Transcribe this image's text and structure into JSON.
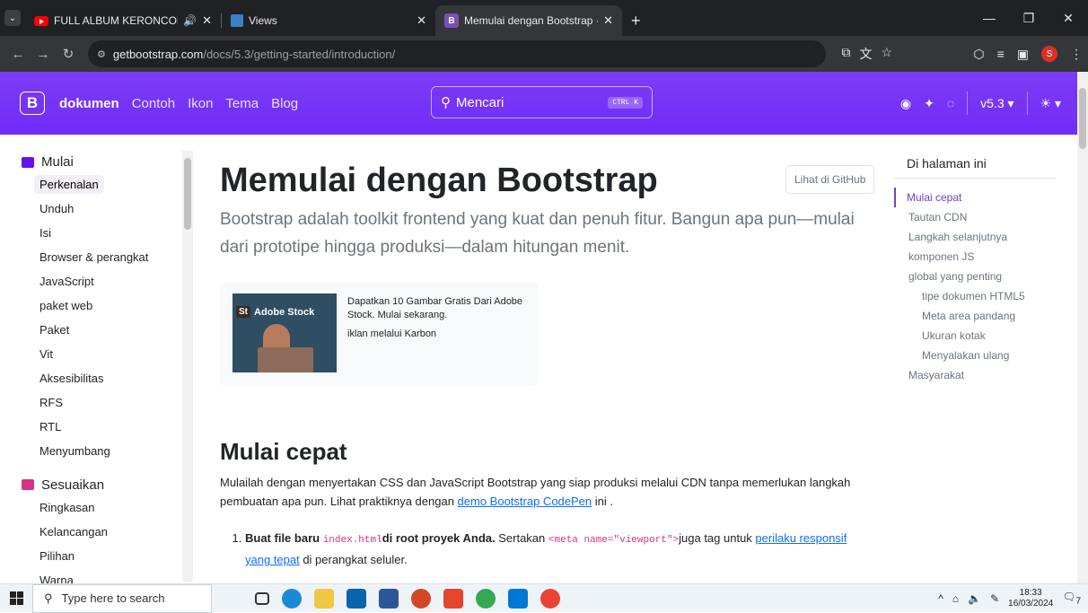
{
  "browser": {
    "tabs": [
      {
        "title": "FULL ALBUM KERONCONG",
        "icon": "youtube-icon",
        "audio": "🔊"
      },
      {
        "title": "Views",
        "icon": "views-icon"
      },
      {
        "title": "Memulai dengan Bootstrap · Bo",
        "icon": "bootstrap-icon"
      }
    ],
    "url_host": "getbootstrap.com",
    "url_path": "/docs/5.3/getting-started/introduction/"
  },
  "navbar": {
    "logo": "B",
    "links": [
      "dokumen",
      "Contoh",
      "Ikon",
      "Tema",
      "Blog"
    ],
    "search_placeholder": "Mencari",
    "search_kbd": "CTRL K",
    "version": "v5.3"
  },
  "sidebar": {
    "section1": {
      "title": "Mulai",
      "items": [
        "Perkenalan",
        "Unduh",
        "Isi",
        "Browser & perangkat",
        "JavaScript",
        "paket web",
        "Paket",
        "Vit",
        "Aksesibilitas",
        "RFS",
        "RTL",
        "Menyumbang"
      ]
    },
    "section2": {
      "title": "Sesuaikan",
      "items": [
        "Ringkasan",
        "Kelancangan",
        "Pilihan",
        "Warna"
      ]
    }
  },
  "main": {
    "title": "Memulai dengan Bootstrap",
    "github_button": "Lihat di GitHub",
    "lead": "Bootstrap adalah toolkit frontend yang kuat dan penuh fitur. Bangun apa pun—mulai dari prototipe hingga produksi—dalam hitungan menit.",
    "ad": {
      "brand": "Adobe Stock",
      "brand_badge": "St",
      "text": "Dapatkan 10 Gambar Gratis Dari Adobe Stock. Mulai sekarang.",
      "via": "iklan melalui Karbon"
    },
    "quickstart_title": "Mulai cepat",
    "quickstart_p1": "Mulailah dengan menyertakan CSS dan JavaScript Bootstrap yang siap produksi melalui CDN tanpa memerlukan langkah pembuatan apa pun. Lihat praktiknya dengan ",
    "quickstart_link": "demo Bootstrap CodePen",
    "quickstart_p2": " ini .",
    "step1_bold1": "Buat file baru ",
    "step1_code1": "index.html",
    "step1_bold2": "di root proyek Anda.",
    "step1_text1": " Sertakan ",
    "step1_code2": "<meta name=\"viewport\">",
    "step1_text2": "juga tag untuk ",
    "step1_link": "perilaku responsif yang tepat",
    "step1_text3": " di perangkat seluler."
  },
  "toc": {
    "title": "Di halaman ini",
    "items": [
      {
        "label": "Mulai cepat",
        "active": true
      },
      {
        "label": "Tautan CDN"
      },
      {
        "label": "Langkah selanjutnya"
      },
      {
        "label": "komponen JS"
      },
      {
        "label": "global yang penting"
      },
      {
        "label": "tipe dokumen HTML5",
        "sub": true
      },
      {
        "label": "Meta area pandang",
        "sub": true
      },
      {
        "label": "Ukuran kotak",
        "sub": true
      },
      {
        "label": "Menyalakan ulang",
        "sub": true
      },
      {
        "label": "Masyarakat"
      }
    ]
  },
  "taskbar": {
    "search_placeholder": "Type here to search",
    "time": "18:33",
    "date": "16/03/2024",
    "notifications": "7"
  },
  "colors": {
    "bootstrap_purple": "#712cf9",
    "link": "#0d6efd",
    "toc_active": "#6f42c1"
  }
}
